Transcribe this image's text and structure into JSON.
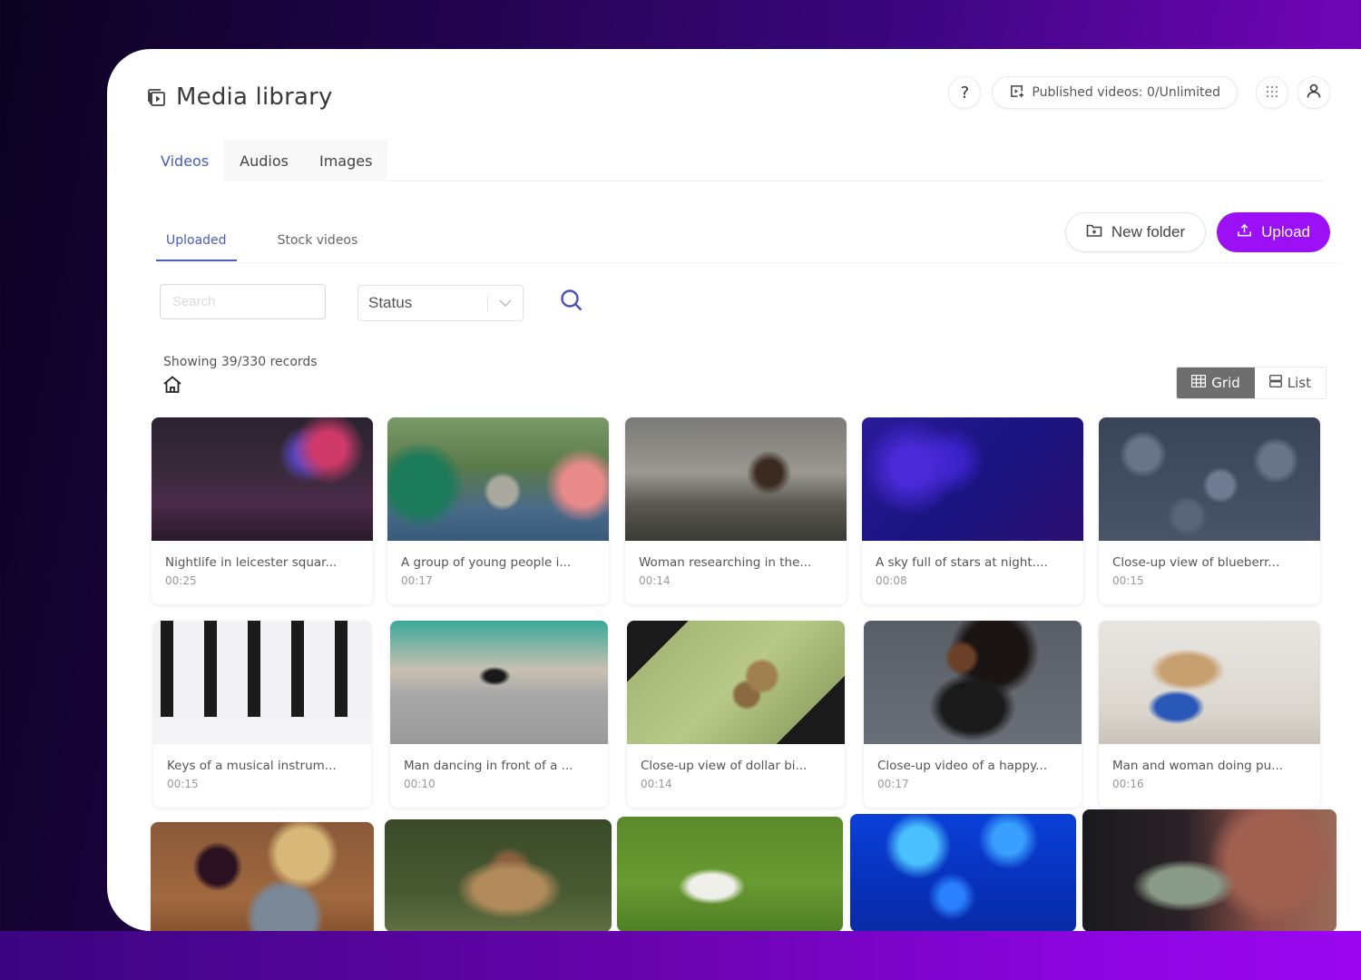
{
  "header": {
    "title": "Media library",
    "published_label": "Published videos: 0/Unlimited",
    "help_label": "?"
  },
  "main_tabs": [
    {
      "label": "Videos",
      "active": true
    },
    {
      "label": "Audios",
      "active": false
    },
    {
      "label": "Images",
      "active": false
    }
  ],
  "sub_tabs": [
    {
      "label": "Uploaded",
      "active": true
    },
    {
      "label": "Stock videos",
      "active": false
    }
  ],
  "actions": {
    "new_folder_label": "New folder",
    "upload_label": "Upload"
  },
  "filters": {
    "search_placeholder": "Search",
    "search_value": "",
    "status_value": "Status"
  },
  "records_text": "Showing 39/330 records",
  "view_toggle": {
    "grid_label": "Grid",
    "list_label": "List",
    "selected": "Grid"
  },
  "colors": {
    "accent": "#4a5bc4",
    "primary_button": "#9b10f5",
    "view_active": "#6e6e6e"
  },
  "videos": [
    {
      "title": "Nightlife in leicester squar...",
      "duration": "00:25",
      "thumb": "night-city-street"
    },
    {
      "title": "A group of young people i...",
      "duration": "00:17",
      "thumb": "students-park-laptop"
    },
    {
      "title": "Woman researching in the...",
      "duration": "00:14",
      "thumb": "woman-library-books"
    },
    {
      "title": "A sky full of stars at night....",
      "duration": "00:08",
      "thumb": "starry-sky"
    },
    {
      "title": "Close-up view of blueberr...",
      "duration": "00:15",
      "thumb": "blueberries"
    },
    {
      "title": "Keys of a musical instrum...",
      "duration": "00:15",
      "thumb": "piano-keys"
    },
    {
      "title": "Man dancing in front of a ...",
      "duration": "00:10",
      "thumb": "man-dancing-street"
    },
    {
      "title": "Close-up view of dollar bi...",
      "duration": "00:14",
      "thumb": "dollar-bills-coins"
    },
    {
      "title": "Close-up video of a happy...",
      "duration": "00:17",
      "thumb": "happy-woman"
    },
    {
      "title": "Man and woman doing pu...",
      "duration": "00:16",
      "thumb": "pushups-home"
    },
    {
      "title": "",
      "duration": "",
      "thumb": "food-wine-table"
    },
    {
      "title": "",
      "duration": "",
      "thumb": "monkey"
    },
    {
      "title": "",
      "duration": "",
      "thumb": "white-dog-grass"
    },
    {
      "title": "",
      "duration": "",
      "thumb": "jellyfish"
    },
    {
      "title": "",
      "duration": "",
      "thumb": "sea-turtle"
    }
  ]
}
